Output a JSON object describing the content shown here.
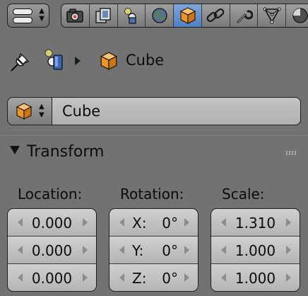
{
  "header_tabs": [
    {
      "icon": "render-icon",
      "label": "Render"
    },
    {
      "icon": "render-layers-icon",
      "label": "Render Layers"
    },
    {
      "icon": "scene-icon",
      "label": "Scene"
    },
    {
      "icon": "world-icon",
      "label": "World"
    },
    {
      "icon": "object-icon",
      "label": "Object",
      "active": true
    },
    {
      "icon": "constraints-icon",
      "label": "Constraints"
    },
    {
      "icon": "modifiers-icon",
      "label": "Modifiers"
    },
    {
      "icon": "data-icon",
      "label": "Data"
    },
    {
      "icon": "material-icon",
      "label": "Material"
    }
  ],
  "context": {
    "object_name": "Cube"
  },
  "object_field": {
    "value": "Cube"
  },
  "transform_panel": {
    "title": "Transform",
    "location": {
      "label": "Location:",
      "values": [
        "0.000",
        "0.000",
        "0.000"
      ]
    },
    "rotation": {
      "label": "Rotation:",
      "axes": [
        "X:",
        "Y:",
        "Z:"
      ],
      "values": [
        "0°",
        "0°",
        "0°"
      ]
    },
    "scale": {
      "label": "Scale:",
      "values": [
        "1.310",
        "1.000",
        "1.000"
      ]
    }
  },
  "colors": {
    "background": "#727272",
    "active_tab": "#5b88cc",
    "field": "#c4c4c4",
    "object_orange": "#e8962c"
  }
}
